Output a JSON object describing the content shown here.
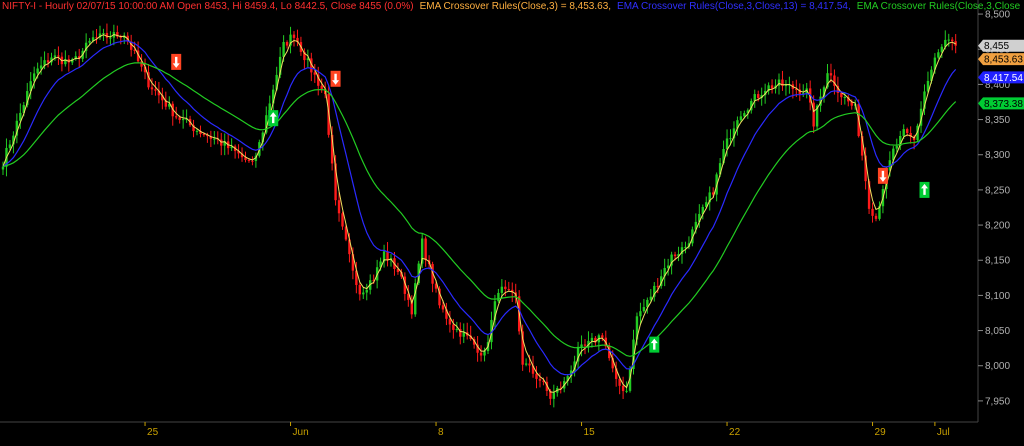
{
  "header": {
    "price_text": "NIFTY-I - Hourly 02/07/15 10:00:00 AM Open 8453, Hi 8459.4, Lo 8442.5, Close 8455 (0.0%)",
    "ema3_text": "EMA Crossover Rules(Close,3) = 8,453.63,",
    "ema13_text": "EMA Crossover Rules(Close,3,Close,13) = 8,417.54,",
    "ema3close_text": "EMA Crossover Rules(Close,3,Close"
  },
  "colors": {
    "background": "#000000",
    "up_bar": "#22cc22",
    "down_bar": "#ff1a1a",
    "ema_short": "#f0e060",
    "ema_medium": "#2a2aff",
    "ema_long": "#22cc22",
    "header_price": "#ff3030",
    "header_ema3": "#ffb040",
    "header_ema13": "#3030ff",
    "header_ema3close": "#22cc22",
    "buy_signal": "#00cc33",
    "sell_signal": "#ff4422",
    "xaxis_text": "#c8a000"
  },
  "chart_data": {
    "type": "line",
    "title": "",
    "xlabel": "",
    "ylabel": "",
    "ylim": [
      7920,
      8520
    ],
    "yticks": [
      7950,
      8000,
      8050,
      8100,
      8150,
      8200,
      8250,
      8300,
      8350,
      8400,
      8450,
      8500
    ],
    "ytick_labels": [
      "7,950",
      "8,000",
      "8,050",
      "8,100",
      "8,150",
      "8,200",
      "8,250",
      "8,300",
      "8,350",
      "8,400",
      "8,450",
      "8,500"
    ],
    "xlim": [
      0,
      280
    ],
    "xticks": [
      {
        "label": "25",
        "x": 41
      },
      {
        "label": "Jun",
        "x": 83
      },
      {
        "label": "8",
        "x": 125
      },
      {
        "label": "15",
        "x": 167
      },
      {
        "label": "22",
        "x": 209
      },
      {
        "label": "29",
        "x": 251
      },
      {
        "label": "Jul",
        "x": 269
      }
    ],
    "price_anchors": [
      [
        0,
        8290
      ],
      [
        4,
        8345
      ],
      [
        9,
        8415
      ],
      [
        14,
        8440
      ],
      [
        20,
        8430
      ],
      [
        26,
        8465
      ],
      [
        35,
        8472
      ],
      [
        42,
        8402
      ],
      [
        50,
        8355
      ],
      [
        56,
        8335
      ],
      [
        62,
        8320
      ],
      [
        68,
        8300
      ],
      [
        72,
        8285
      ],
      [
        74,
        8315
      ],
      [
        78,
        8395
      ],
      [
        81,
        8455
      ],
      [
        84,
        8472
      ],
      [
        88,
        8430
      ],
      [
        93,
        8385
      ],
      [
        96,
        8230
      ],
      [
        100,
        8155
      ],
      [
        103,
        8105
      ],
      [
        107,
        8125
      ],
      [
        110,
        8160
      ],
      [
        114,
        8135
      ],
      [
        118,
        8080
      ],
      [
        121,
        8175
      ],
      [
        126,
        8085
      ],
      [
        130,
        8055
      ],
      [
        134,
        8040
      ],
      [
        139,
        8015
      ],
      [
        143,
        8110
      ],
      [
        148,
        8095
      ],
      [
        150,
        8005
      ],
      [
        155,
        7980
      ],
      [
        158,
        7955
      ],
      [
        162,
        7975
      ],
      [
        166,
        8020
      ],
      [
        169,
        8030
      ],
      [
        173,
        8045
      ],
      [
        177,
        7975
      ],
      [
        180,
        7965
      ],
      [
        183,
        8070
      ],
      [
        186,
        8090
      ],
      [
        190,
        8130
      ],
      [
        193,
        8155
      ],
      [
        197,
        8170
      ],
      [
        201,
        8210
      ],
      [
        205,
        8250
      ],
      [
        208,
        8305
      ],
      [
        212,
        8355
      ],
      [
        216,
        8375
      ],
      [
        220,
        8395
      ],
      [
        224,
        8400
      ],
      [
        228,
        8395
      ],
      [
        232,
        8390
      ],
      [
        234,
        8345
      ],
      [
        238,
        8420
      ],
      [
        242,
        8385
      ],
      [
        246,
        8365
      ],
      [
        248,
        8300
      ],
      [
        250,
        8230
      ],
      [
        252,
        8210
      ],
      [
        254,
        8255
      ],
      [
        257,
        8305
      ],
      [
        260,
        8330
      ],
      [
        263,
        8320
      ],
      [
        266,
        8390
      ],
      [
        269,
        8435
      ],
      [
        272,
        8460
      ],
      [
        275,
        8455
      ]
    ],
    "last_bar_index": 275,
    "series": [
      {
        "name": "EMA Crossover Rules(Close,3)",
        "last": 8453.63
      },
      {
        "name": "EMA Crossover Rules(Close,3,Close,13)",
        "last": 8417.54
      },
      {
        "name": "EMA Crossover Rules(Close,3,Close",
        "last": 8373.38
      }
    ],
    "signals": [
      {
        "type": "sell",
        "x": 50,
        "y": 8432
      },
      {
        "type": "buy",
        "x": 78,
        "y": 8352
      },
      {
        "type": "sell",
        "x": 96,
        "y": 8408
      },
      {
        "type": "buy",
        "x": 188,
        "y": 8030
      },
      {
        "type": "sell",
        "x": 254,
        "y": 8270
      },
      {
        "type": "buy",
        "x": 266,
        "y": 8250
      }
    ],
    "price_labels": [
      {
        "text": "8,455",
        "value": 8455,
        "bg": "#d0d0d0",
        "fg": "#000000"
      },
      {
        "text": "8,453.63",
        "value": 8436,
        "bg": "#f0a040",
        "fg": "#000000"
      },
      {
        "text": "8,417.54",
        "value": 8410,
        "bg": "#2020ff",
        "fg": "#ffffff"
      },
      {
        "text": "8,373.38",
        "value": 8373,
        "bg": "#00cc33",
        "fg": "#000000"
      }
    ]
  }
}
